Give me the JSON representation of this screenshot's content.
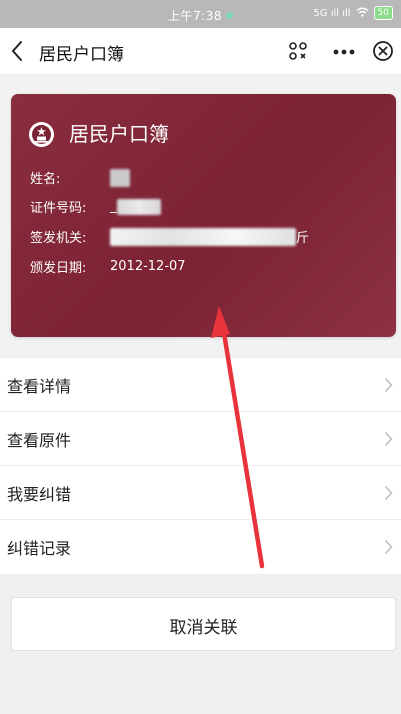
{
  "status_bar": {
    "time": "上午7:38",
    "signal": "5G ıll ıll",
    "battery": "50"
  },
  "nav": {
    "title": "居民户口簿"
  },
  "card": {
    "title": "居民户口簿",
    "fields": [
      {
        "label": "姓名:",
        "value": ""
      },
      {
        "label": "证件号码:",
        "value": "_"
      },
      {
        "label": "签发机关:",
        "value": "斤"
      },
      {
        "label": "颁发日期:",
        "value": "2012-12-07"
      }
    ]
  },
  "menu": {
    "items": [
      {
        "label": "查看详情"
      },
      {
        "label": "查看原件"
      },
      {
        "label": "我要纠错"
      },
      {
        "label": "纠错记录"
      }
    ]
  },
  "footer": {
    "unlink_label": "取消关联"
  },
  "colors": {
    "card": "#7b2233",
    "annotation": "#e8333a"
  }
}
